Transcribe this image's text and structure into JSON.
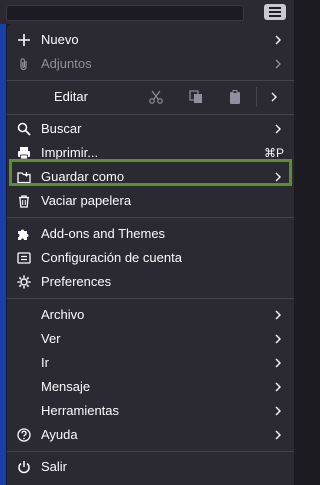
{
  "menu": {
    "items_top": [
      {
        "label": "Nuevo",
        "icon": "plus-icon"
      },
      {
        "label": "Adjuntos",
        "icon": "paperclip-icon",
        "disabled": true
      }
    ],
    "edit": {
      "label": "Editar",
      "icons": [
        "scissors-icon",
        "copy-icon",
        "paste-icon"
      ]
    },
    "items_mid": [
      {
        "label": "Buscar",
        "icon": "search-icon"
      },
      {
        "label": "Imprimir...",
        "icon": "printer-icon",
        "shortcut": "⌘P"
      },
      {
        "label": "Guardar como",
        "icon": "save-as-icon"
      },
      {
        "label": "Vaciar papelera",
        "icon": "trash-icon"
      }
    ],
    "items_settings": [
      {
        "label": "Add-ons and Themes",
        "icon": "puzzle-icon"
      },
      {
        "label": "Configuración de cuenta",
        "icon": "account-settings-icon"
      },
      {
        "label": "Preferences",
        "icon": "gear-icon"
      }
    ],
    "items_sub": [
      {
        "label": "Archivo"
      },
      {
        "label": "Ver"
      },
      {
        "label": "Ir"
      },
      {
        "label": "Mensaje"
      },
      {
        "label": "Herramientas"
      },
      {
        "label": "Ayuda",
        "icon": "help-icon"
      }
    ],
    "quit": {
      "label": "Salir",
      "icon": "power-icon"
    }
  },
  "colors": {
    "panel_bg": "#2b2a33",
    "text": "#fbfbfe",
    "disabled_text": "#8f8f9d",
    "highlight_border": "#5b8e2f"
  }
}
